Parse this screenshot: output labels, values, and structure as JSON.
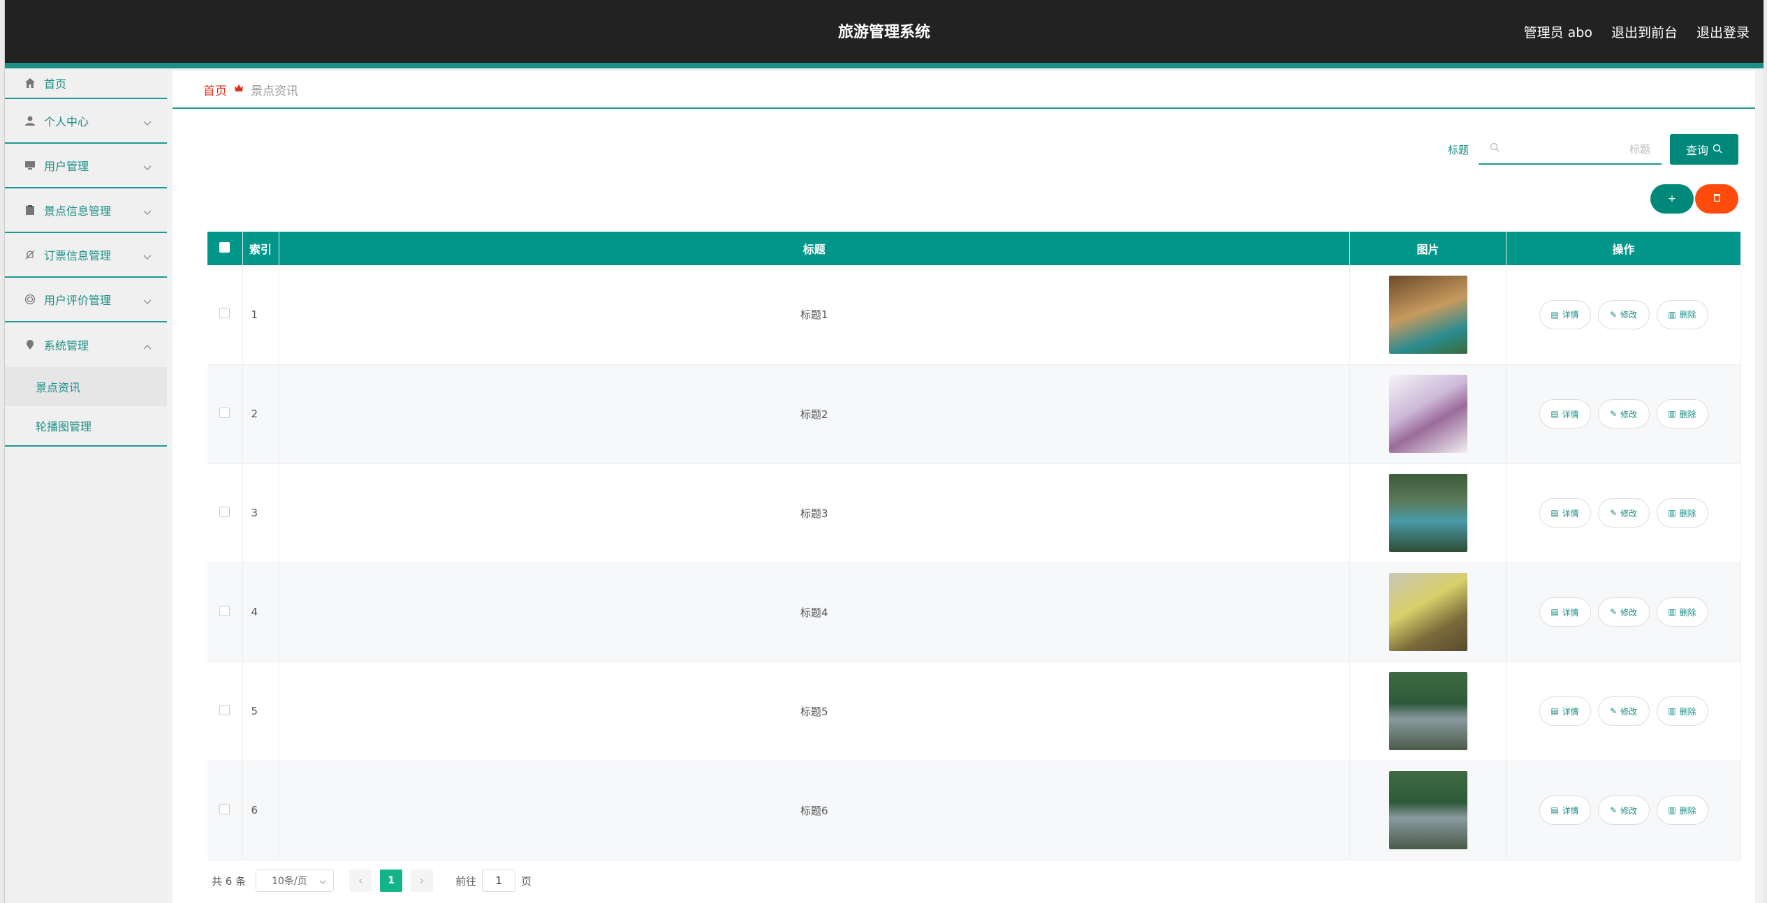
{
  "header": {
    "title": "旅游管理系统",
    "admin": "管理员 abo",
    "front": "退出到前台",
    "logout": "退出登录"
  },
  "sidebar": {
    "items": [
      {
        "label": "首页",
        "icon": "home-icon"
      },
      {
        "label": "个人中心",
        "icon": "user-icon"
      },
      {
        "label": "用户管理",
        "icon": "monitor-icon"
      },
      {
        "label": "景点信息管理",
        "icon": "clipboard-icon"
      },
      {
        "label": "订票信息管理",
        "icon": "bell-off-icon"
      },
      {
        "label": "用户评价管理",
        "icon": "target-icon"
      },
      {
        "label": "系统管理",
        "icon": "location-icon"
      }
    ],
    "sub": [
      {
        "label": "景点资讯"
      },
      {
        "label": "轮播图管理"
      }
    ]
  },
  "breadcrumb": {
    "home": "首页",
    "current": "景点资讯"
  },
  "search": {
    "label": "标题",
    "placeholder": "标题",
    "button": "查询"
  },
  "actions": {
    "add": "+",
    "delete": "🗑"
  },
  "table": {
    "headers": {
      "index": "索引",
      "title": "标题",
      "image": "图片",
      "ops": "操作"
    },
    "rows": [
      {
        "index": "1",
        "title": "标题1"
      },
      {
        "index": "2",
        "title": "标题2"
      },
      {
        "index": "3",
        "title": "标题3"
      },
      {
        "index": "4",
        "title": "标题4"
      },
      {
        "index": "5",
        "title": "标题5"
      },
      {
        "index": "6",
        "title": "标题6"
      }
    ],
    "op_labels": {
      "detail": "详情",
      "edit": "修改",
      "remove": "删除"
    }
  },
  "pager": {
    "total": "共 6 条",
    "size": "10条/页",
    "page": "1",
    "goto": "前往",
    "goto_value": "1",
    "page_unit": "页"
  },
  "colors": {
    "accent": "#00897b",
    "danger": "#ff4c0c",
    "header": "#222222"
  }
}
